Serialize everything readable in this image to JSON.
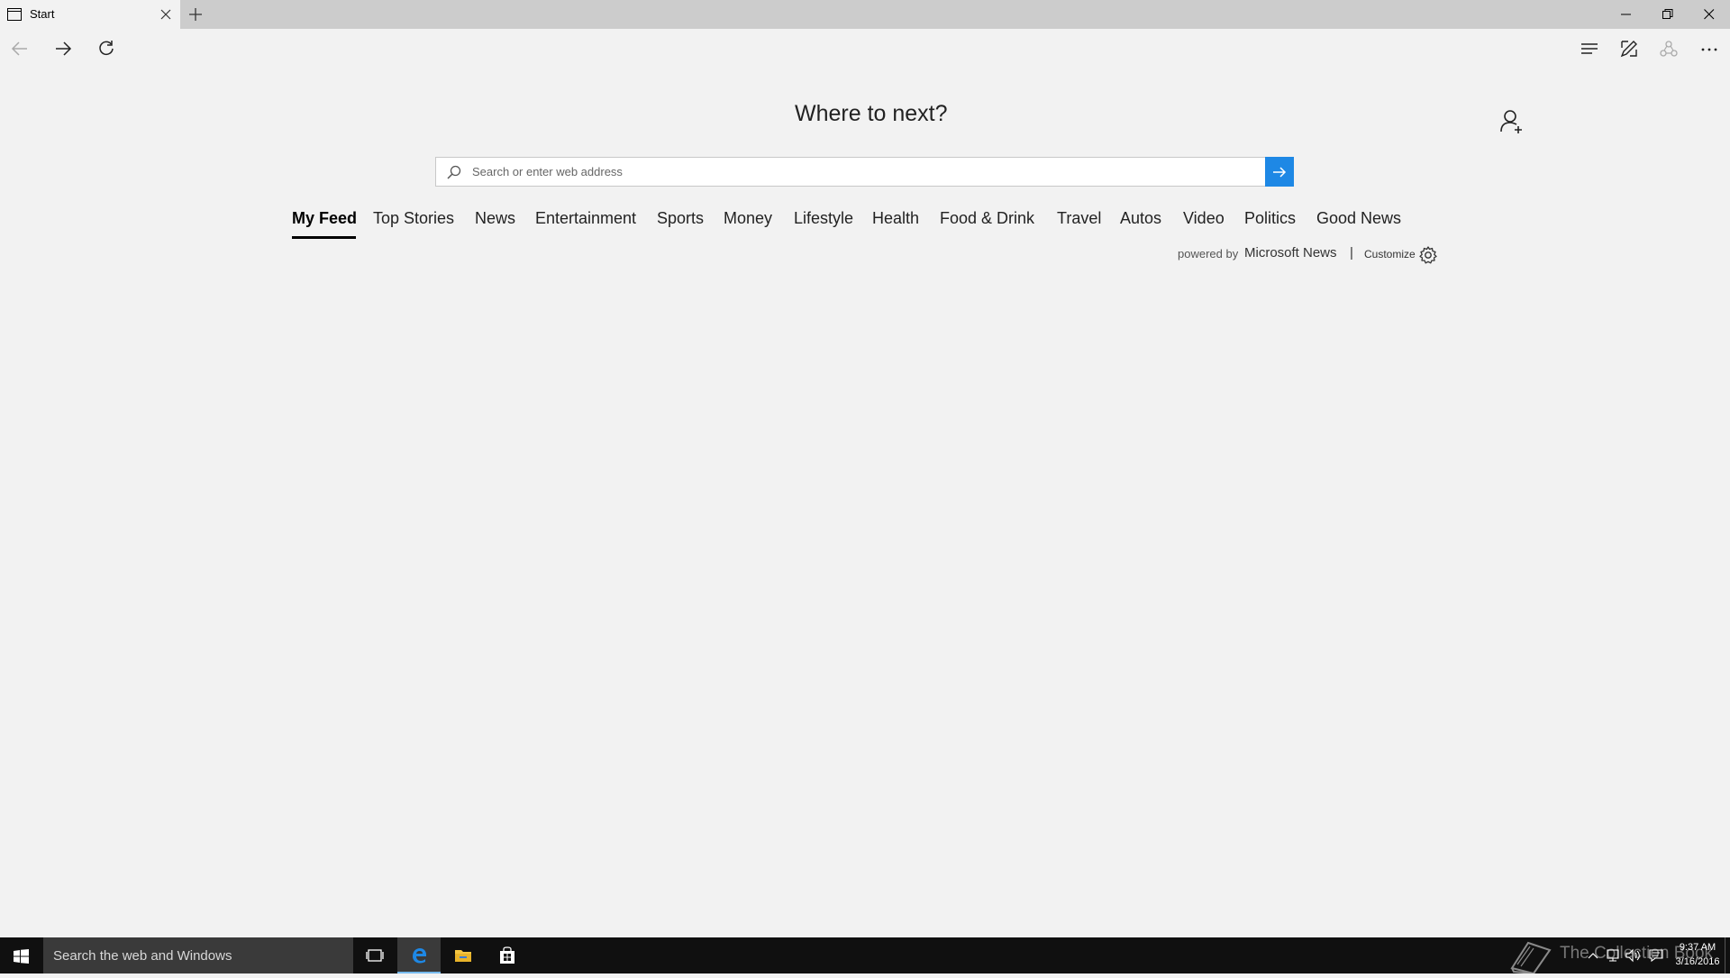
{
  "browser": {
    "tab": {
      "title": "Start"
    },
    "window_controls": [
      "minimize",
      "restore",
      "close"
    ],
    "nav": {
      "back": "back",
      "forward": "forward",
      "refresh": "refresh"
    },
    "toolbar_right": [
      "hub",
      "web-note",
      "share",
      "more"
    ]
  },
  "start_page": {
    "heading": "Where to next?",
    "search": {
      "placeholder": "Search or enter web address",
      "value": ""
    },
    "feed_tabs": [
      {
        "label": "My Feed",
        "active": true
      },
      {
        "label": "Top Stories",
        "active": false
      },
      {
        "label": "News",
        "active": false
      },
      {
        "label": "Entertainment",
        "active": false
      },
      {
        "label": "Sports",
        "active": false
      },
      {
        "label": "Money",
        "active": false
      },
      {
        "label": "Lifestyle",
        "active": false
      },
      {
        "label": "Health",
        "active": false
      },
      {
        "label": "Food & Drink",
        "active": false
      },
      {
        "label": "Travel",
        "active": false
      },
      {
        "label": "Autos",
        "active": false
      },
      {
        "label": "Video",
        "active": false
      },
      {
        "label": "Politics",
        "active": false
      },
      {
        "label": "Good News",
        "active": false
      }
    ],
    "powered_by": "powered by",
    "powered_brand": "Microsoft News",
    "separator": "|",
    "customize": "Customize"
  },
  "taskbar": {
    "search_placeholder": "Search the web and Windows",
    "pinned": [
      "task-view",
      "edge",
      "file-explorer",
      "store"
    ],
    "clock": {
      "time": "9:37 AM",
      "date": "3/16/2016"
    },
    "watermark": "The Collection Book"
  },
  "colors": {
    "accent": "#1e88e5",
    "background": "#f2f2f2",
    "tabstrip": "#cccccc",
    "taskbar": "#101010"
  }
}
